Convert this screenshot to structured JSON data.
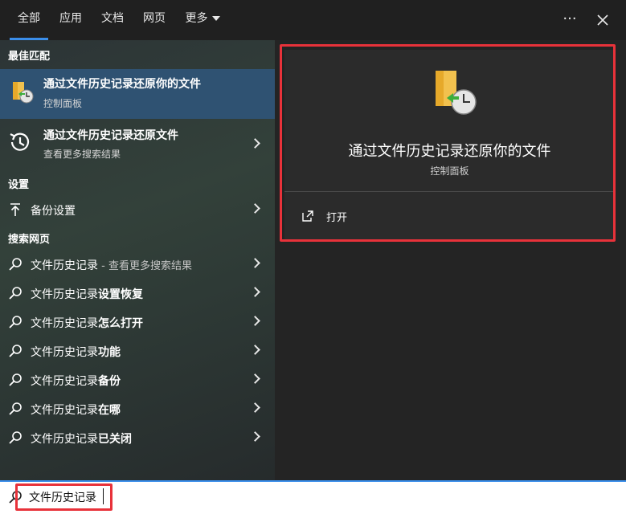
{
  "tabs": [
    {
      "label": "全部",
      "active": true
    },
    {
      "label": "应用"
    },
    {
      "label": "文档"
    },
    {
      "label": "网页"
    },
    {
      "label": "更多"
    }
  ],
  "top_icons": {
    "more": "ellipsis-icon",
    "close": "close-icon"
  },
  "sections": {
    "best_match": "最佳匹配",
    "settings": "设置",
    "web": "搜索网页"
  },
  "best_match": {
    "title": "通过文件历史记录还原你的文件",
    "subtitle": "控制面板",
    "icon": "file-history-folder-icon"
  },
  "second_result": {
    "title": "通过文件历史记录还原文件",
    "subtitle": "查看更多搜索结果",
    "icon": "history-clock-icon"
  },
  "settings_item": {
    "label": "备份设置",
    "icon": "upload-arrow-icon"
  },
  "web_items": [
    {
      "plain": "文件历史记录",
      "bold": "",
      "muted": " - 查看更多搜索结果"
    },
    {
      "plain": "文件历史记录",
      "bold": "设置恢复",
      "muted": ""
    },
    {
      "plain": "文件历史记录",
      "bold": "怎么打开",
      "muted": ""
    },
    {
      "plain": "文件历史记录",
      "bold": "功能",
      "muted": ""
    },
    {
      "plain": "文件历史记录",
      "bold": "备份",
      "muted": ""
    },
    {
      "plain": "文件历史记录",
      "bold": "在哪",
      "muted": ""
    },
    {
      "plain": "文件历史记录",
      "bold": "已关闭",
      "muted": ""
    }
  ],
  "detail": {
    "title": "通过文件历史记录还原你的文件",
    "subtitle": "控制面板",
    "action_label": "打开",
    "action_icon": "open-external-icon"
  },
  "search": {
    "value": "文件历史记录",
    "icon": "search-icon"
  },
  "colors": {
    "accent": "#3b8eea",
    "highlight": "#e8323a",
    "selected": "#2f5272"
  }
}
